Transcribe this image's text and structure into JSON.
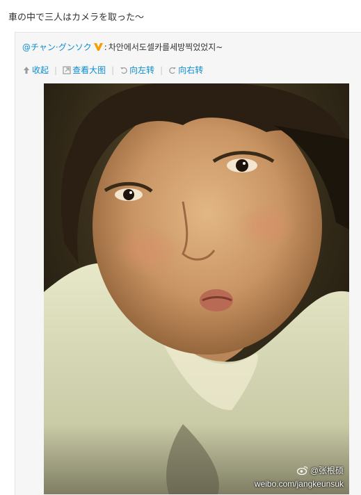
{
  "post": {
    "text": "車の中で三人はカメラを取った〜"
  },
  "repost": {
    "author": "@チャン·グンソク",
    "badge_icon": "verified-v-icon",
    "colon": ":",
    "text": "차안에서도셀카를세방찍었었지~",
    "actions": [
      {
        "icon": "arrow-up-icon",
        "label": "收起"
      },
      {
        "icon": "zoom-icon",
        "label": "查看大图"
      },
      {
        "icon": "rotate-left-icon",
        "label": "向左转"
      },
      {
        "icon": "rotate-right-icon",
        "label": "向右转"
      }
    ],
    "photo": {
      "watermark_name": "@张根硕",
      "watermark_url": "weibo.com/jangkeunsuk"
    }
  },
  "colors": {
    "link": "#0a8cd2",
    "badge": "#f5a000"
  }
}
